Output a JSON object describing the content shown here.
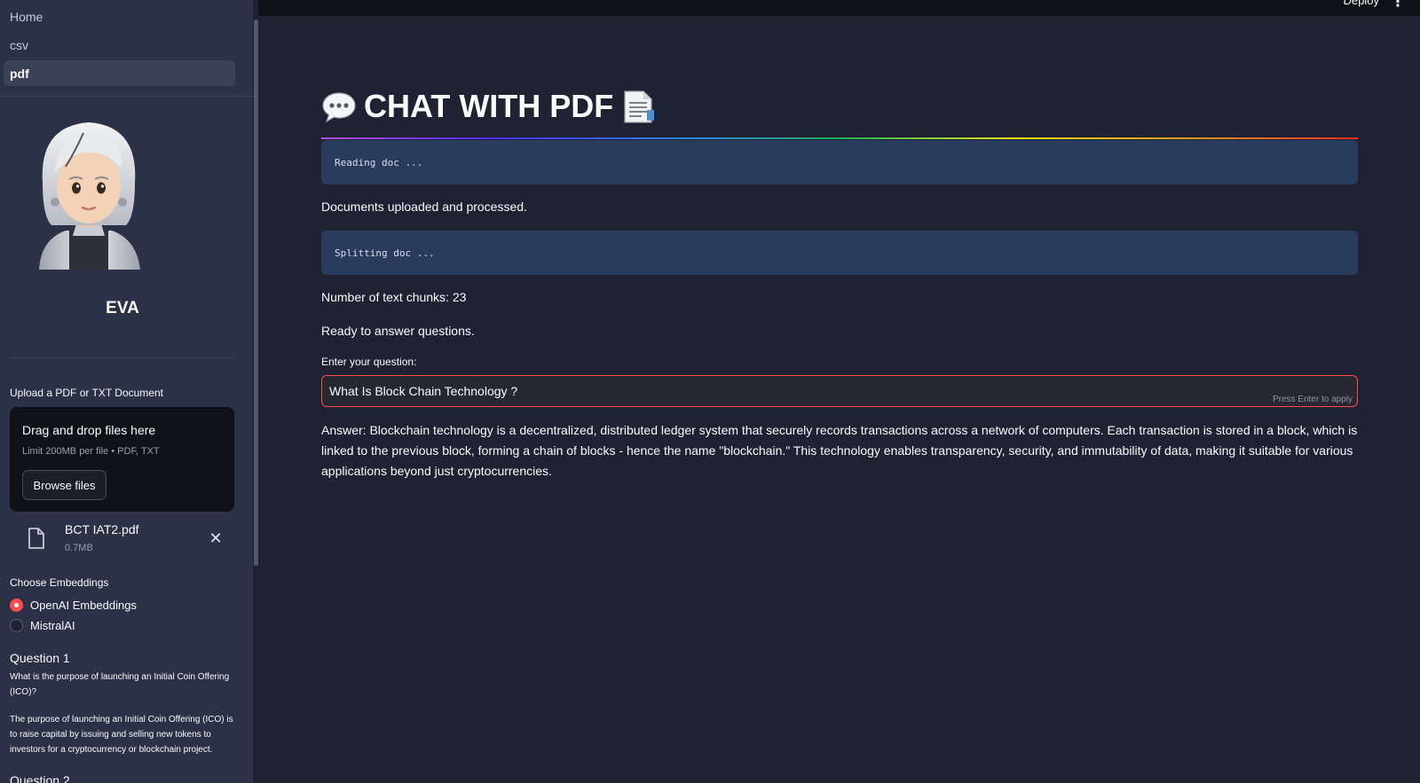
{
  "nav": {
    "items": [
      {
        "label": "Home",
        "active": false
      },
      {
        "label": "csv",
        "active": false
      },
      {
        "label": "pdf",
        "active": true
      }
    ]
  },
  "sidebar": {
    "app_name": "EVA",
    "upload_label": "Upload a PDF or TXT Document",
    "dropzone_title": "Drag and drop files here",
    "dropzone_limit": "Limit 200MB per file • PDF, TXT",
    "browse_label": "Browse files",
    "file": {
      "name": "BCT IAT2.pdf",
      "size": "0.7MB"
    },
    "embeddings_label": "Choose Embeddings",
    "embeddings_options": [
      {
        "label": "OpenAI Embeddings",
        "selected": true
      },
      {
        "label": "MistralAI",
        "selected": false
      }
    ],
    "questions": [
      {
        "title": "Question 1",
        "question": "What is the purpose of launching an Initial Coin Offering (ICO)?",
        "answer": "The purpose of launching an Initial Coin Offering (ICO) is to raise capital by issuing and selling new tokens to investors for a cryptocurrency or blockchain project."
      },
      {
        "title": "Question 2"
      }
    ]
  },
  "topbar": {
    "deploy_label": "Deploy",
    "menu_icon": "kebab-menu-icon"
  },
  "main": {
    "title": "CHAT WITH PDF",
    "title_icons": [
      "speech-bubble-icon",
      "document-icon"
    ],
    "status_reading": "Reading doc ...",
    "msg_uploaded": "Documents uploaded and processed.",
    "status_splitting": "Splitting doc ...",
    "msg_chunks": "Number of text chunks: 23",
    "msg_ready": "Ready to answer questions.",
    "question_label": "Enter your question:",
    "question_value": "What Is Block Chain Technology ?",
    "question_hint": "Press Enter to apply",
    "answer": "Answer: Blockchain technology is a decentralized, distributed ledger system that securely records transactions across a network of computers. Each transaction is stored in a block, which is linked to the previous block, forming a chain of blocks - hence the name \"blockchain.\" This technology enables transparency, security, and immutability of data, making it suitable for various applications beyond just cryptocurrencies."
  },
  "colors": {
    "sidebar_bg": "#2b3147",
    "main_bg": "#1e2233",
    "accent": "#ff4b4b",
    "code_bg": "#2a3c5e"
  }
}
